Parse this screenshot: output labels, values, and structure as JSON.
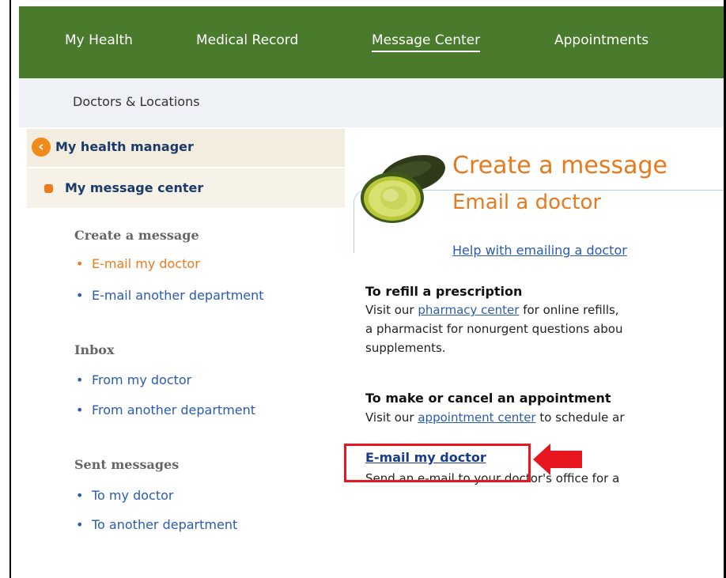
{
  "nav": {
    "items": [
      "My Health",
      "Medical Record",
      "Message Center",
      "Appointments"
    ],
    "sub_link": "Doctors & Locations"
  },
  "sidebar": {
    "manager": "My health manager",
    "message_center": "My message center",
    "sections": [
      {
        "heading": "Create a message",
        "links": [
          "E-mail my doctor",
          "E-mail another department"
        ]
      },
      {
        "heading": "Inbox",
        "links": [
          "From my doctor",
          "From another department"
        ]
      },
      {
        "heading": "Sent messages",
        "links": [
          "To my doctor",
          "To another department"
        ]
      }
    ]
  },
  "content": {
    "title": "Create a message",
    "subtitle": "Email a doctor",
    "help_link": "Help with emailing a doctor",
    "refill": {
      "heading": "To refill a prescription",
      "line1_pre": "Visit our ",
      "line1_link": "pharmacy center",
      "line1_post": " for online refills,",
      "line2": "a pharmacist for nonurgent questions abou",
      "line3": "supplements."
    },
    "appt": {
      "heading": "To make or cancel an appointment",
      "line1_pre": "Visit our ",
      "line1_link": "appointment center",
      "line1_post": " to schedule ar"
    },
    "email": {
      "link": "E-mail my doctor",
      "desc": "Send an e-mail to your doctor's office for a"
    }
  },
  "colors": {
    "nav_green": "#4a7a2b",
    "accent_orange": "#e87a1e",
    "link_blue": "#2a5bb3",
    "highlight_red": "#e8161e"
  }
}
